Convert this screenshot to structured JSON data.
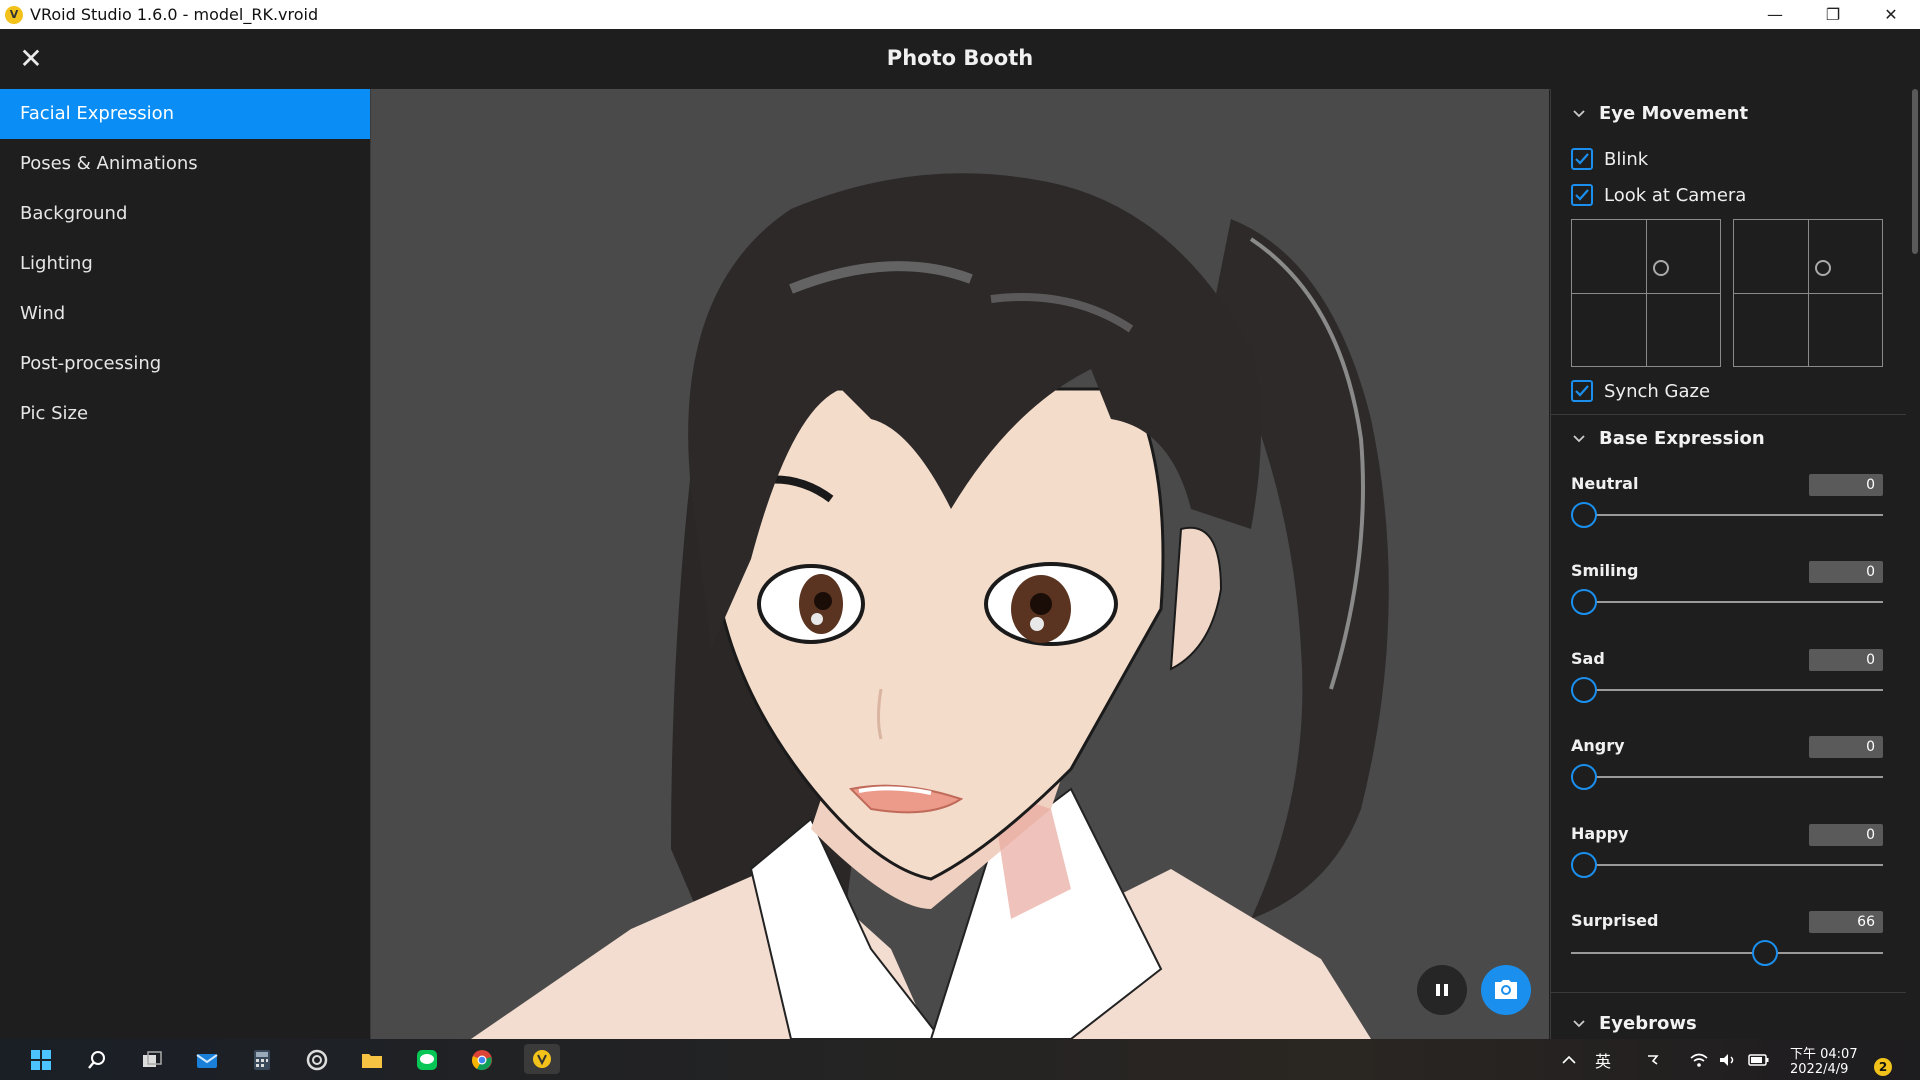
{
  "window": {
    "title": "VRoid Studio 1.6.0 - model_RK.vroid",
    "controls": [
      "minimize",
      "restore",
      "close"
    ]
  },
  "header": {
    "title": "Photo Booth",
    "close_icon": "close-icon"
  },
  "sidebar": {
    "items": [
      {
        "label": "Facial Expression",
        "active": true
      },
      {
        "label": "Poses & Animations",
        "active": false
      },
      {
        "label": "Background",
        "active": false
      },
      {
        "label": "Lighting",
        "active": false
      },
      {
        "label": "Wind",
        "active": false
      },
      {
        "label": "Post-processing",
        "active": false
      },
      {
        "label": "Pic Size",
        "active": false
      }
    ]
  },
  "viewport": {
    "pause_icon": "pause-icon",
    "camera_icon": "camera-icon"
  },
  "panel": {
    "eye_movement": {
      "title": "Eye Movement",
      "blink": {
        "label": "Blink",
        "checked": true
      },
      "look_at_camera": {
        "label": "Look at Camera",
        "checked": true
      },
      "synch_gaze": {
        "label": "Synch Gaze",
        "checked": true
      }
    },
    "base_expression": {
      "title": "Base Expression",
      "sliders": [
        {
          "label": "Neutral",
          "value": "0"
        },
        {
          "label": "Smiling",
          "value": "0"
        },
        {
          "label": "Sad",
          "value": "0"
        },
        {
          "label": "Angry",
          "value": "0"
        },
        {
          "label": "Happy",
          "value": "0"
        },
        {
          "label": "Surprised",
          "value": "66"
        }
      ]
    },
    "eyebrows": {
      "title": "Eyebrows"
    }
  },
  "taskbar": {
    "apps": [
      "windows-start-icon",
      "search-icon",
      "task-view-icon",
      "mail-icon",
      "calculator-icon",
      "app-icon",
      "file-explorer-icon",
      "line-icon",
      "chrome-icon",
      "vroid-icon"
    ],
    "tray": {
      "ime": "英",
      "clock_time": "下午 04:07",
      "clock_date": "2022/4/9",
      "notifications": "2"
    }
  },
  "colors": {
    "accent": "#0a8ef5",
    "panel_bg": "#1e1e1e",
    "viewport_bg": "#4a4a4a"
  }
}
